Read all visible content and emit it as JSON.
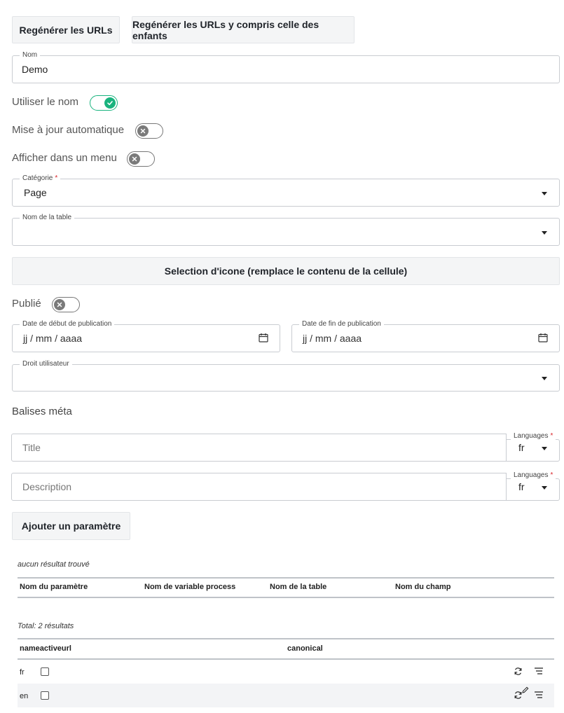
{
  "toolbar": {
    "regen_label": "Regénérer les URLs",
    "regen_children_label": "Regénérer les URLs y compris celle des enfants"
  },
  "name_field": {
    "label": "Nom",
    "value": "Demo"
  },
  "toggles": {
    "use_name": {
      "label": "Utiliser le nom",
      "on": true
    },
    "auto_update": {
      "label": "Mise à jour automatique",
      "on": false
    },
    "show_in_menu": {
      "label": "Afficher dans un menu",
      "on": false
    },
    "published": {
      "label": "Publié",
      "on": false
    }
  },
  "category": {
    "label": "Catégorie",
    "required_mark": "*",
    "value": "Page"
  },
  "table_name": {
    "label": "Nom de la table",
    "value": ""
  },
  "icon_selection_label": "Selection d'icone (remplace le contenu de la cellule)",
  "dates": {
    "start": {
      "label": "Date de début de publication",
      "placeholder": "jj / mm / aaaa"
    },
    "end": {
      "label": "Date de fin de publication",
      "placeholder": "jj / mm / aaaa"
    }
  },
  "user_right": {
    "label": "Droit utilisateur",
    "value": ""
  },
  "meta": {
    "heading": "Balises méta",
    "title": {
      "placeholder": "Title",
      "lang_label": "Languages",
      "required_mark": "*",
      "lang_value": "fr"
    },
    "description": {
      "placeholder": "Description",
      "lang_label": "Languages",
      "required_mark": "*",
      "lang_value": "fr"
    }
  },
  "add_param_label": "Ajouter un paramètre",
  "params_table": {
    "empty_text": "aucun résultat trouvé",
    "headers": [
      "Nom du paramètre",
      "Nom de variable process",
      "Nom de la table",
      "Nom du champ"
    ]
  },
  "url_table": {
    "total_text": "Total: 2 résultats",
    "headers": {
      "left": "nameactiveurl",
      "right": "canonical"
    },
    "rows": [
      {
        "name": "fr",
        "active": false
      },
      {
        "name": "en",
        "active": false
      }
    ]
  },
  "colors": {
    "toggle_on": "#19b37e",
    "toggle_off": "#7a7a7a",
    "required": "#d9252b",
    "row_alt": "#f3f4f6"
  }
}
